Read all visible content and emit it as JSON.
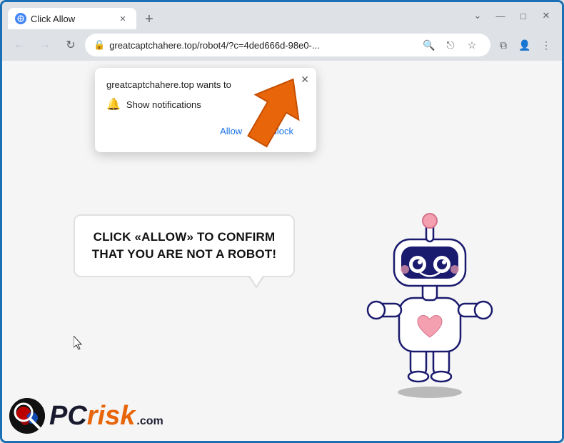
{
  "browser": {
    "tab": {
      "title": "Click Allow",
      "favicon_label": "globe-icon"
    },
    "new_tab_label": "+",
    "window_controls": {
      "chevron": "⌄",
      "minimize": "—",
      "maximize": "□",
      "close": "✕"
    },
    "address_bar": {
      "url": "greatcaptchahere.top/robot4/?c=4ded666d-98e0-...",
      "lock_icon": "🔒",
      "search_label": "search-icon",
      "share_label": "share-icon",
      "bookmark_label": "bookmark-icon",
      "extensions_label": "extensions-icon",
      "profile_label": "profile-icon",
      "menu_label": "menu-icon"
    },
    "nav": {
      "back": "←",
      "forward": "→",
      "refresh": "↻"
    }
  },
  "notification_popup": {
    "site_text": "greatcaptchahere.top wants to",
    "close_label": "✕",
    "notification_icon": "🔔",
    "notification_text": "Show notifications",
    "allow_button": "Allow",
    "block_button": "Block"
  },
  "speech_bubble": {
    "text": "CLICK «ALLOW» TO CONFIRM THAT YOU ARE NOT A ROBOT!"
  },
  "pcrisk": {
    "logo_text": "PC",
    "logo_colored": "risk",
    "dot_com": ".com"
  }
}
